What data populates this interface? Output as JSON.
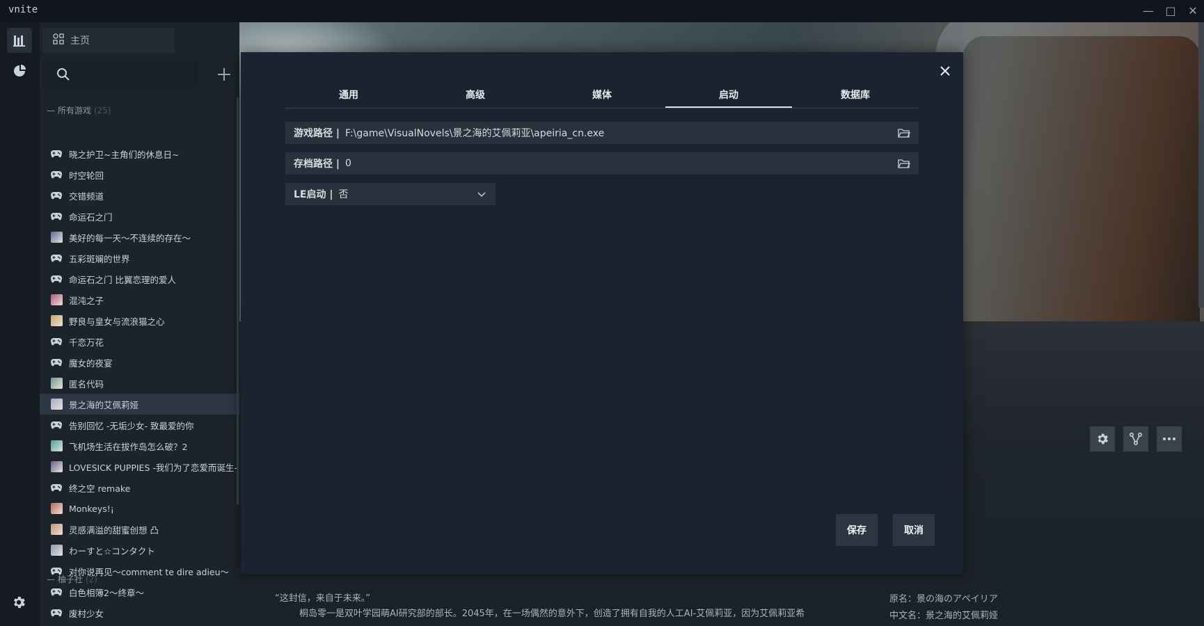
{
  "window": {
    "title": "vnite"
  },
  "sidebar": {
    "home_label": "主页",
    "groups": [
      {
        "name": "所有游戏",
        "count": "(25)"
      },
      {
        "name": "柚子社",
        "count": "(2)"
      }
    ],
    "items": [
      {
        "label": "晓之护卫~主角们的休息日~",
        "icon": "gamepad-icon"
      },
      {
        "label": "时空轮回",
        "icon": "gamepad-icon"
      },
      {
        "label": "交错频道",
        "icon": "gamepad-icon"
      },
      {
        "label": "命运石之门",
        "icon": "gamepad-icon"
      },
      {
        "label": "美好的每一天～不连续的存在～",
        "icon": "cover-thumbnail",
        "color": "#5a6f9a"
      },
      {
        "label": "五彩斑斓的世界",
        "icon": "gamepad-icon"
      },
      {
        "label": "命运石之门 比翼恋理的爱人",
        "icon": "gamepad-icon"
      },
      {
        "label": "混沌之子",
        "icon": "cover-thumbnail",
        "color": "#b05a78"
      },
      {
        "label": "野良与皇女与流浪猫之心",
        "icon": "cover-thumbnail",
        "color": "#c9a36a"
      },
      {
        "label": "千恋万花",
        "icon": "gamepad-icon"
      },
      {
        "label": "魔女的夜宴",
        "icon": "gamepad-icon"
      },
      {
        "label": "匿名代码",
        "icon": "cover-thumbnail",
        "color": "#6f9a8a"
      },
      {
        "label": "景之海的艾佩莉娅",
        "icon": "cover-thumbnail",
        "color": "#a7a9c2",
        "selected": true
      },
      {
        "label": "告别回忆 -无垢少女- 致最爱的你",
        "icon": "gamepad-icon"
      },
      {
        "label": "飞机场生活在拔作岛怎么破？2",
        "icon": "cover-thumbnail",
        "color": "#4aa39a"
      },
      {
        "label": "LOVESICK PUPPIES -我们为了恋爱而诞生-",
        "icon": "cover-thumbnail",
        "color": "#6a5f8e"
      },
      {
        "label": "终之空 remake",
        "icon": "gamepad-icon"
      },
      {
        "label": "Monkeys!¡",
        "icon": "cover-thumbnail",
        "color": "#b56a5a"
      },
      {
        "label": "灵感满溢的甜蜜创想 凸",
        "icon": "cover-thumbnail",
        "color": "#c99070"
      },
      {
        "label": "わーすと☆コンタクト",
        "icon": "cover-thumbnail",
        "color": "#8a9ab5"
      },
      {
        "label": "对你说再见～comment te dire adieu～",
        "icon": "gamepad-icon"
      },
      {
        "label": "白色相簿2～终章～",
        "icon": "gamepad-icon"
      },
      {
        "label": "废村少女",
        "icon": "gamepad-icon"
      }
    ]
  },
  "modal": {
    "tabs": [
      "通用",
      "高级",
      "媒体",
      "启动",
      "数据库"
    ],
    "active_tab": "启动",
    "game_path": {
      "label": "游戏路径 |",
      "value": "F:\\game\\VisualNovels\\景之海的艾佩莉亚\\apeiria_cn.exe"
    },
    "save_path": {
      "label": "存档路径 |",
      "value": "0"
    },
    "le_launch": {
      "label": "LE启动 |",
      "value": "否"
    },
    "save_button": "保存",
    "cancel_button": "取消"
  },
  "details": {
    "desc_line1": "“这封信，来自于未来。”",
    "desc_line2": "桐岛零一是双叶学园萌AI研究部的部长。2045年，在一场偶然的意外下，创造了拥有自我的人工AI-艾佩莉亚，因为艾佩莉亚希",
    "original_name": "原名：景の海のアペイリア",
    "chinese_name": "中文名：景之海的艾佩莉娅"
  },
  "colors": {
    "accent": "#d9dee4",
    "selected_row": "#2d3744",
    "modal_bg": "#1b2230"
  }
}
